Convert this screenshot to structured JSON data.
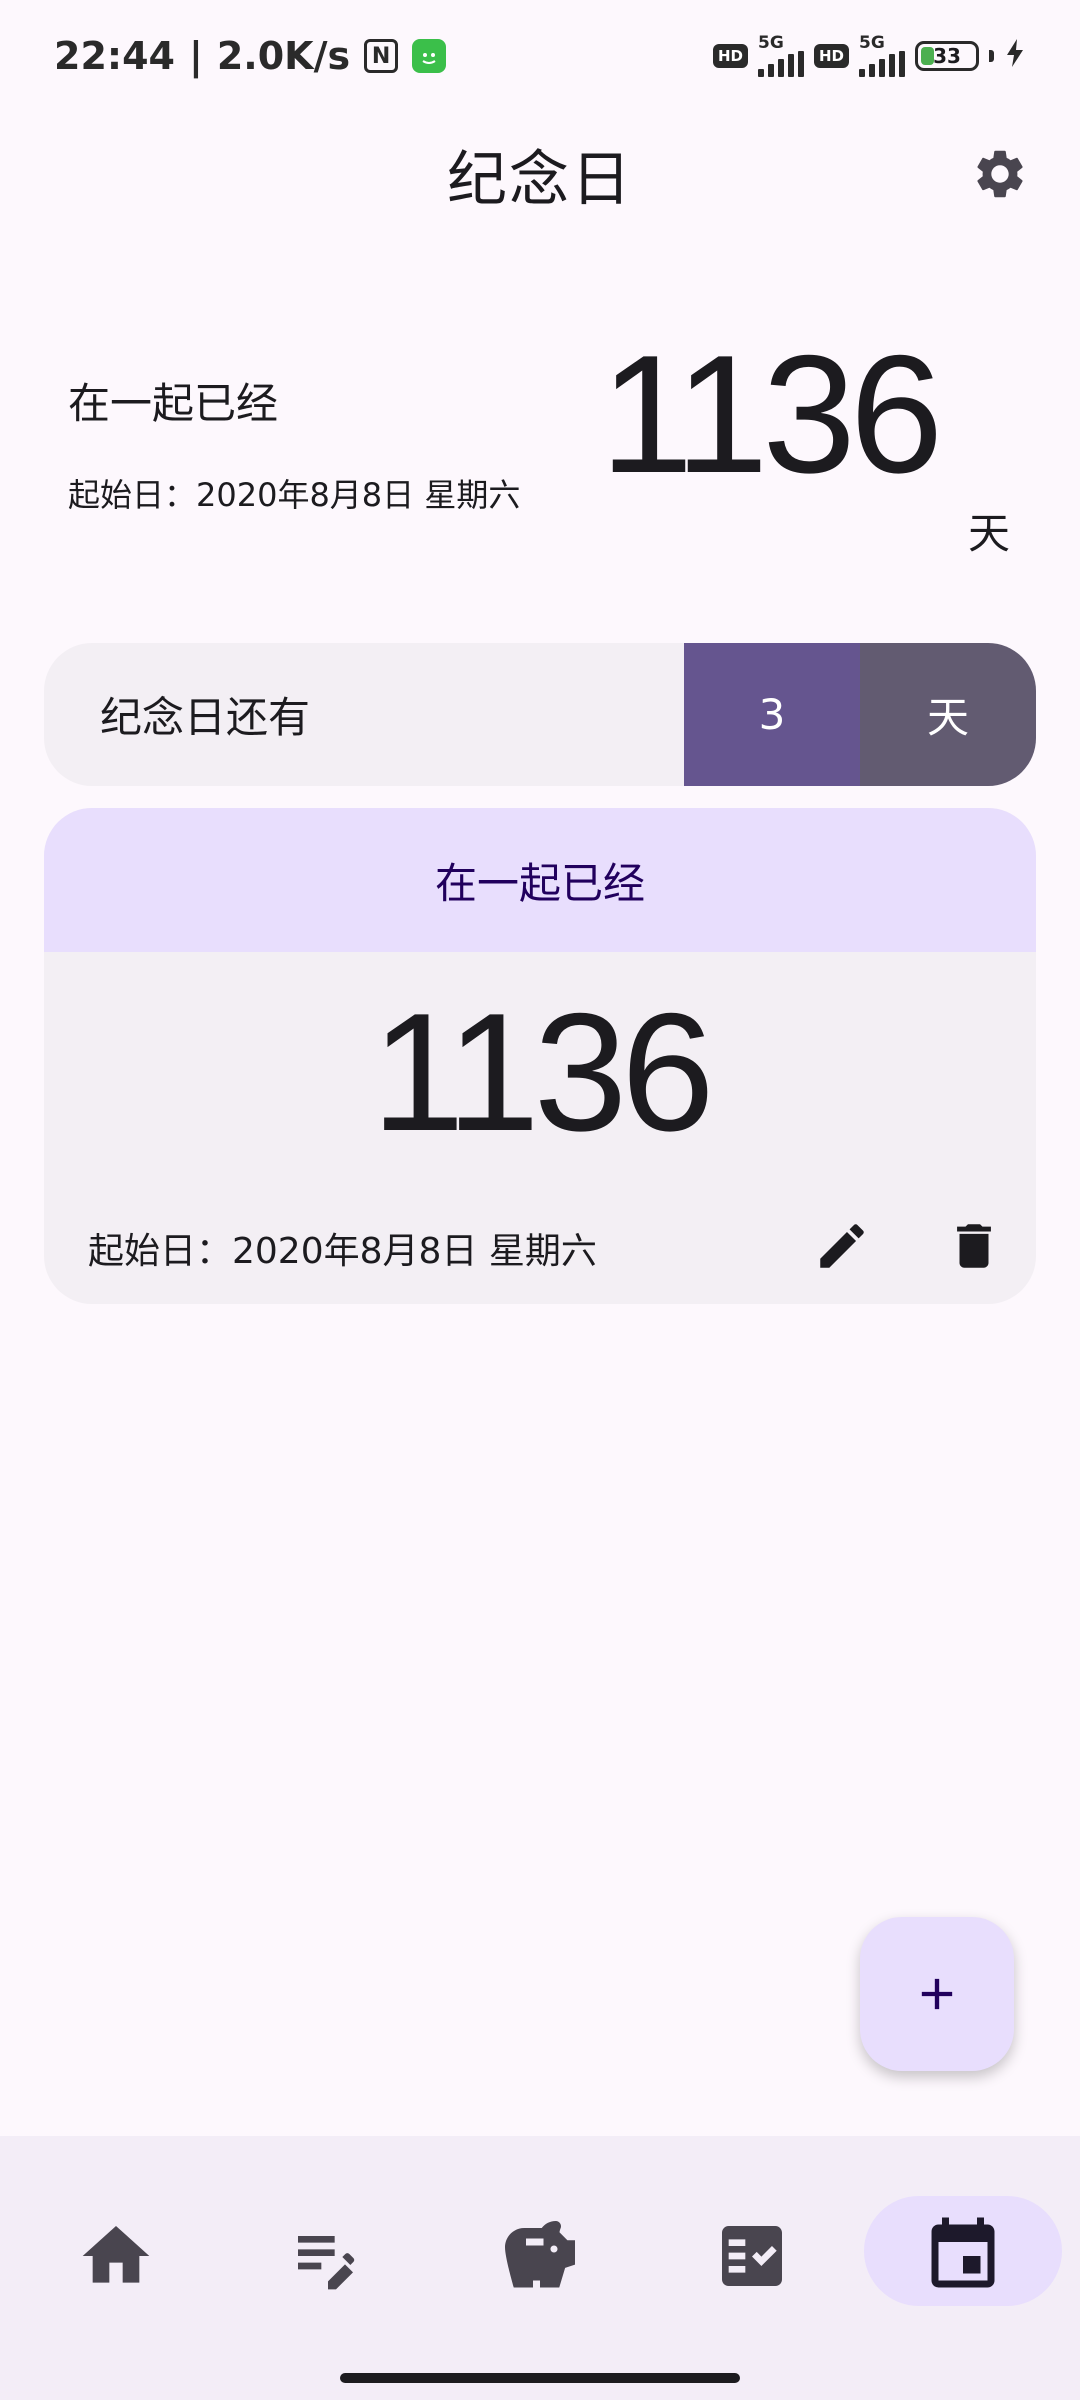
{
  "status_bar": {
    "time": "22:44",
    "separator": "|",
    "speed": "2.0K/s",
    "nfc_glyph": "N",
    "hd1": "HD",
    "net1": "5G",
    "hd2": "HD",
    "net2": "5G",
    "battery": "33",
    "battery_level": 0.33
  },
  "app_bar": {
    "title": "纪念日",
    "settings_icon": "gear-icon"
  },
  "hero": {
    "label": "在一起已经",
    "start_date": "起始日：2020年8月8日 星期六",
    "days": "1136",
    "unit": "天"
  },
  "countdown": {
    "label": "纪念日还有",
    "value": "3",
    "unit": "天"
  },
  "card": {
    "header": "在一起已经",
    "days": "1136",
    "start_date": "起始日：2020年8月8日 星期六",
    "edit_icon": "pencil-icon",
    "delete_icon": "trash-icon"
  },
  "fab": {
    "icon": "plus-icon"
  },
  "bottom_nav": {
    "items": [
      {
        "icon": "home-icon"
      },
      {
        "icon": "edit-list-icon"
      },
      {
        "icon": "piggy-bank-icon"
      },
      {
        "icon": "checklist-icon"
      },
      {
        "icon": "calendar-icon",
        "active": true
      }
    ]
  },
  "colors": {
    "background": "#fdf8fd",
    "accent": "#65558f",
    "accent_secondary": "#625b71",
    "container": "#e8defd",
    "surface": "#f3eff4"
  }
}
